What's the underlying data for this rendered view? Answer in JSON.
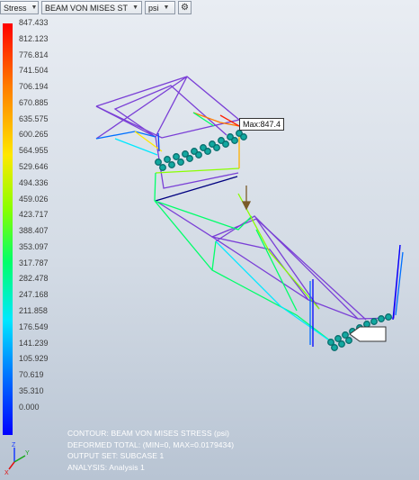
{
  "toolbar": {
    "result_select": "Stress",
    "type_select": "BEAM VON MISES STRESS",
    "unit_select": "psi",
    "settings_icon": "settings-icon"
  },
  "legend": {
    "values": [
      "847.433",
      "812.123",
      "776.814",
      "741.504",
      "706.194",
      "670.885",
      "635.575",
      "600.265",
      "564.955",
      "529.646",
      "494.336",
      "459.026",
      "423.717",
      "388.407",
      "353.097",
      "317.787",
      "282.478",
      "247.168",
      "211.858",
      "176.549",
      "141.239",
      "105.929",
      "70.619",
      "35.310",
      "0.000"
    ]
  },
  "callout": {
    "max_label": "Max:847.4"
  },
  "info": {
    "contour": "CONTOUR: BEAM VON MISES STRESS (psi)",
    "deformed": "DEFORMED TOTAL: (MIN=0, MAX=0.0179434)",
    "output_set": "OUTPUT SET: SUBCASE 1",
    "analysis": "ANALYSIS: Analysis 1"
  },
  "triad": {
    "x": "X",
    "y": "Y",
    "z": "Z"
  }
}
